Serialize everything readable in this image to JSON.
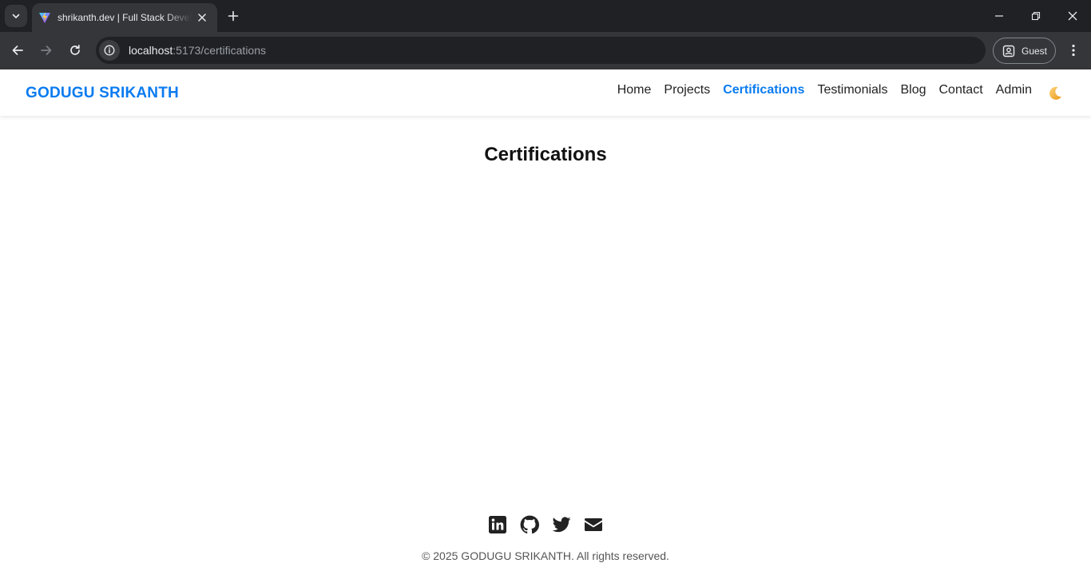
{
  "browser": {
    "tab_title": "shrikanth.dev | Full Stack Developer",
    "url_host": "localhost",
    "url_path": ":5173/certifications",
    "profile_label": "Guest"
  },
  "site": {
    "brand": "GODUGU SRIKANTH",
    "nav": [
      {
        "label": "Home",
        "active": false
      },
      {
        "label": "Projects",
        "active": false
      },
      {
        "label": "Certifications",
        "active": true
      },
      {
        "label": "Testimonials",
        "active": false
      },
      {
        "label": "Blog",
        "active": false
      },
      {
        "label": "Contact",
        "active": false
      },
      {
        "label": "Admin",
        "active": false
      }
    ],
    "theme_toggle_icon": "moon-icon",
    "accent_color": "#0a7bf0"
  },
  "main": {
    "title": "Certifications"
  },
  "footer": {
    "social_icons": [
      "linkedin-icon",
      "github-icon",
      "twitter-icon",
      "envelope-icon"
    ],
    "copyright": "© 2025 GODUGU SRIKANTH. All rights reserved."
  }
}
